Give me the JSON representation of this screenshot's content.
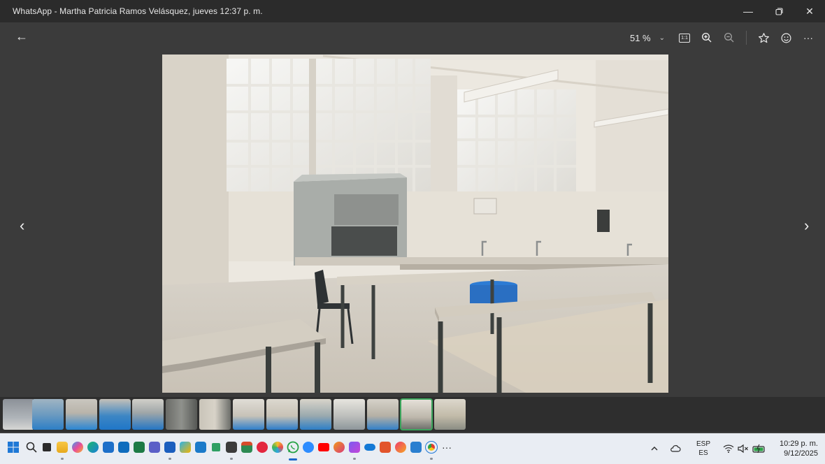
{
  "window": {
    "title": "WhatsApp - Martha Patricia Ramos Velásquez, jueves 12:37 p. m.",
    "controls": [
      "minimize-icon",
      "restore-icon",
      "close-icon"
    ]
  },
  "toolbar": {
    "back_icon": "arrow-left-icon",
    "zoom_label": "51 %",
    "zoom_dropdown_icon": "chevron-down-icon",
    "actual_size_label": "1:1",
    "zoom_in_icon": "zoom-in-icon",
    "zoom_out_icon": "zoom-out-icon",
    "favorite_icon": "star-icon",
    "react_icon": "smiley-icon",
    "more_icon": "more-icon"
  },
  "viewer": {
    "image_subject": "laboratory room with fume hood, windows and tables",
    "prev_icon": "chevron-left-icon",
    "next_icon": "chevron-right-icon"
  },
  "filmstrip": {
    "count": 14,
    "selected_index": 12
  },
  "taskbar": {
    "apps": [
      "windows-start-icon",
      "search-icon",
      "task-view-icon",
      "file-explorer-icon",
      "copilot-icon",
      "edge-icon",
      "store-icon",
      "outlook-icon",
      "excel-icon",
      "teams-icon",
      "word-icon",
      "photos-icon",
      "whiteboard-icon",
      "todo-icon",
      "calculator-icon",
      "calendar-icon",
      "media-icon",
      "pinwheel-icon",
      "whatsapp-icon",
      "zoom-icon",
      "youtube-icon",
      "paint-icon",
      "clipchamp-icon",
      "onedrive-icon",
      "kahoot-icon",
      "game-icon",
      "remote-icon",
      "chrome-icon",
      "overflow-icon"
    ],
    "tray": {
      "chevron_icon": "chevron-up-icon",
      "cloud_icon": "cloud-icon",
      "lang_top": "ESP",
      "lang_bottom": "ES",
      "wifi_icon": "wifi-icon",
      "volume_icon": "volume-muted-icon",
      "battery_icon": "battery-charging-icon",
      "time": "10:29 p. m.",
      "date": "9/12/2025"
    }
  }
}
